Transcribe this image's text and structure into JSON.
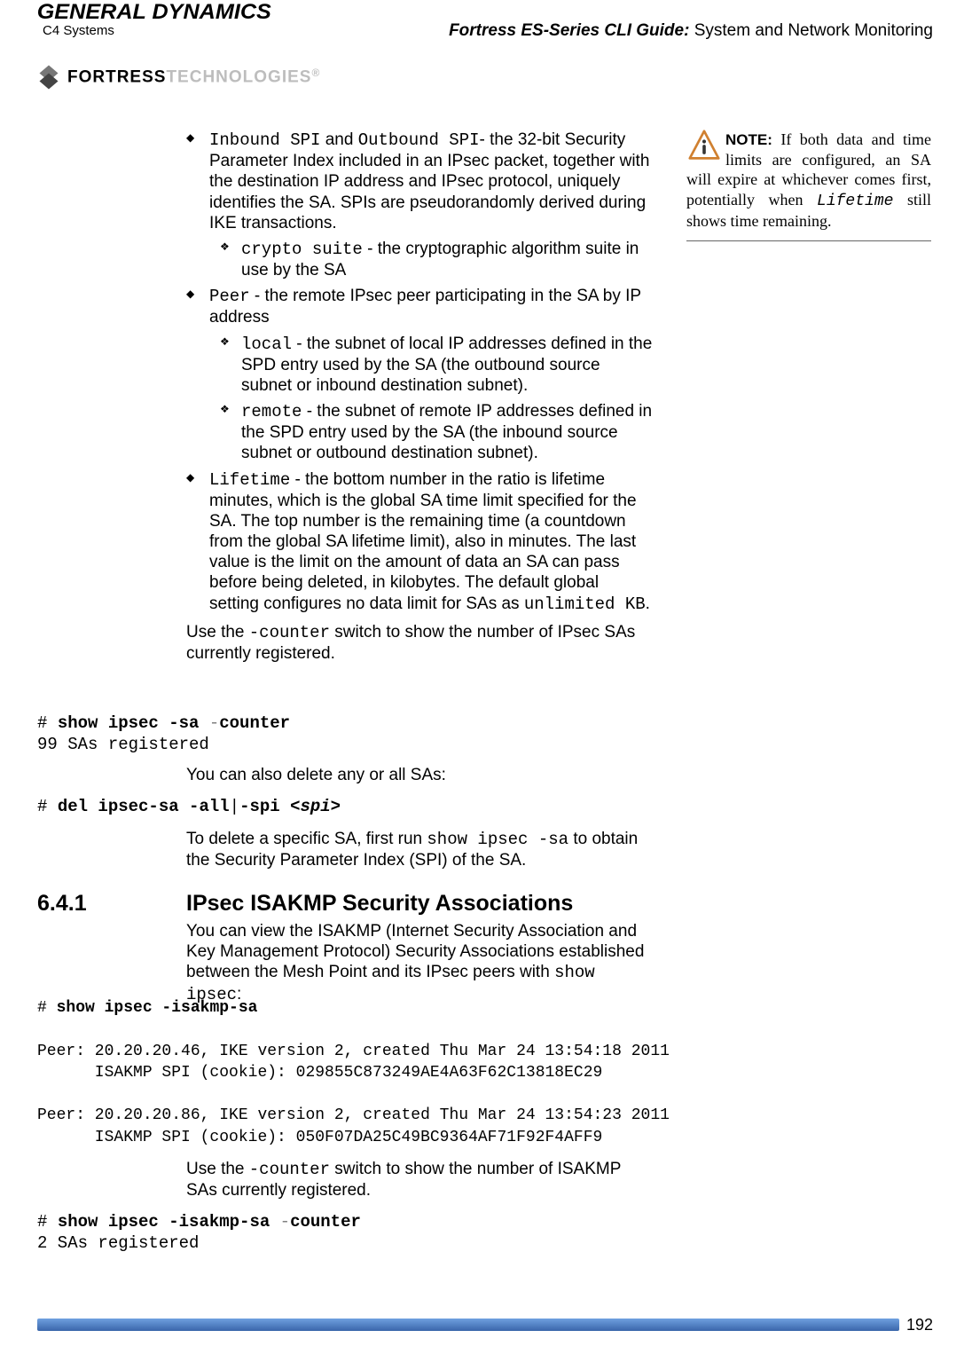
{
  "header": {
    "gd_main": "GENERAL DYNAMICS",
    "gd_sub": "C4 Systems",
    "fortress1": "FORTRESS",
    "fortress2": "TECHNOLOGIES",
    "guide_italic": "Fortress ES-Series CLI Guide:",
    "guide_rest": " System and Network Monitoring"
  },
  "bullets": {
    "b1": {
      "code1": "Inbound SPI",
      "mid": " and ",
      "code2": "Outbound SPI",
      "rest": "- the 32-bit Security Parameter Index included in an IPsec packet, together with the destination IP address and IPsec protocol, uniquely identifies the SA. SPIs are pseudorandomly derived during IKE transactions."
    },
    "b1s1": {
      "code": "crypto suite",
      "rest": " - the cryptographic algorithm suite in use by the SA"
    },
    "b2": {
      "code": "Peer",
      "rest": " - the remote IPsec peer participating in the SA by IP address"
    },
    "b2s1": {
      "code": "local",
      "rest": " - the subnet of local IP addresses defined in the SPD entry used by the SA (the outbound source subnet or inbound destination subnet)."
    },
    "b2s2": {
      "code": "remote",
      "rest": " - the subnet of remote IP addresses defined in the SPD entry used by the SA (the inbound source subnet or outbound destination subnet)."
    },
    "b3": {
      "code": "Lifetime",
      "rest": " - the bottom number in the ratio is lifetime minutes, which is the global SA time limit specified for the SA. The top number is the remaining time (a countdown from the global SA lifetime limit), also in minutes. The last value is the limit on the amount of data an SA can pass before being deleted, in kilobytes. The default global setting configures no data limit for SAs as ",
      "code_end": "unlimited KB",
      "period": "."
    }
  },
  "paras": {
    "p1a": "Use the ",
    "p1_code": "-counter",
    "p1b": " switch to show the number of IPsec SAs currently registered.",
    "p2": "You can also delete any or all SAs:",
    "p3a": "To delete a specific SA, first run ",
    "p3_code": "show ipsec -sa",
    "p3b": " to obtain the Security Parameter Index (SPI) of the SA.",
    "p4a": "You can view the ISAKMP (Internet Security Association and Key Management Protocol) Security Associations established between the Mesh Point and its IPsec peers with ",
    "p4_code": "show ipsec",
    "p4b": ":",
    "p5a": "Use the ",
    "p5_code": "-counter",
    "p5b": " switch to show the number of ISAKMP SAs currently registered."
  },
  "codeblocks": {
    "c1_prompt": "# ",
    "c1_bold": "show ipsec -sa ",
    "c1_grey": "-",
    "c1_bold2": "counter",
    "c1_line2": "99 SAs registered",
    "c2_prompt": "# ",
    "c2_bold": "del ipsec-sa -all",
    "c2_pipe": "|",
    "c2_bold2": "-spi ",
    "c2_arg": "<spi>",
    "c3_prompt": "# ",
    "c3_bold": "show ipsec -isakmp-sa",
    "c3_p1l1": "Peer: 20.20.20.46, IKE version 2, created Thu Mar 24 13:54:18 2011",
    "c3_p1l2": "      ISAKMP SPI (cookie): 029855C873249AE4A63F62C13818EC29",
    "c3_p2l1": "Peer: 20.20.20.86, IKE version 2, created Thu Mar 24 13:54:23 2011",
    "c3_p2l2": "      ISAKMP SPI (cookie): 050F07DA25C49BC9364AF71F92F4AFF9",
    "c4_prompt": "# ",
    "c4_bold": "show ipsec -isakmp-sa ",
    "c4_grey": "-",
    "c4_bold2": "counter",
    "c4_line2": "2 SAs registered"
  },
  "section": {
    "num": "6.4.1",
    "title": "IPsec ISAKMP Security Associations"
  },
  "sidenote": {
    "label": "NOTE:",
    "t1": " If both data and time limits are configured, an SA will expire at whichever comes first, potentially when ",
    "life": "Lifetime",
    "t2": " still shows time remaining."
  },
  "footer": {
    "pagenum": "192"
  }
}
